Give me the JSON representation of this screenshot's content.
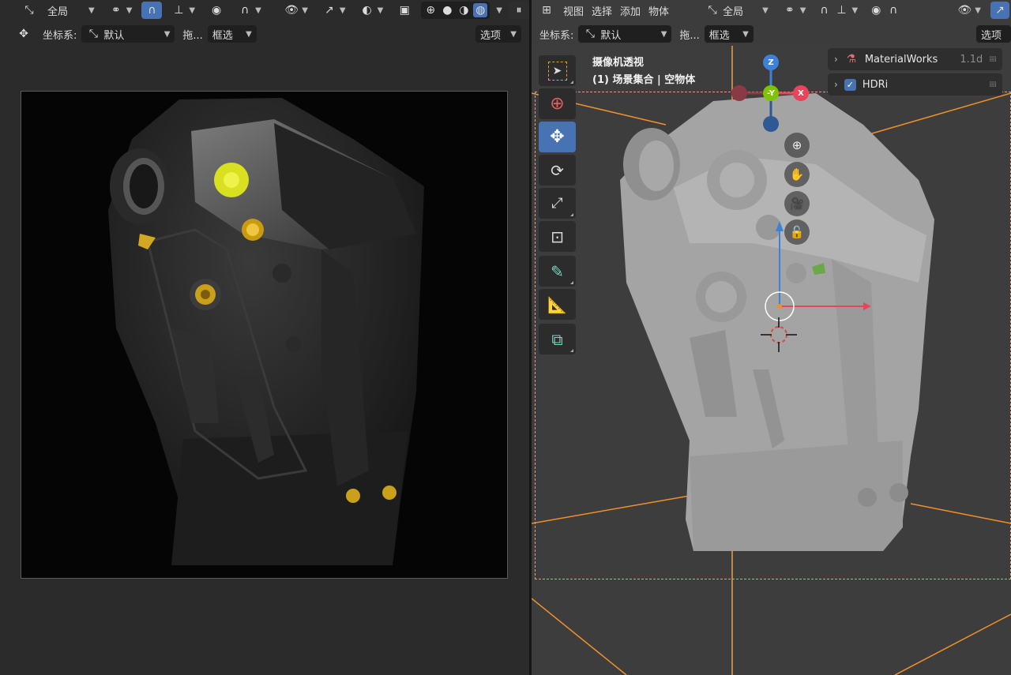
{
  "left_header": {
    "orientation_value": "全局",
    "coord_label": "坐标系:",
    "coord_value": "默认",
    "drag_label": "拖...",
    "select_mode": "框选",
    "options": "选项"
  },
  "right_header": {
    "menu": [
      "视图",
      "选择",
      "添加",
      "物体"
    ],
    "orientation_value": "全局",
    "coord_label": "坐标系:",
    "coord_value": "默认",
    "drag_label": "拖...",
    "select_mode": "框选",
    "options": "选项"
  },
  "viewport": {
    "title": "摄像机透视",
    "subtitle": "(1) 场景集合 | 空物体",
    "gizmo": {
      "z": "Z",
      "y": "-Y",
      "x": "X"
    }
  },
  "npanel": {
    "items": [
      {
        "label": "MaterialWorks",
        "version": "1.1d"
      },
      {
        "label": "HDRi",
        "checked": true
      }
    ]
  },
  "colors": {
    "accent": "#4772b3",
    "axis_x": "#e8445a",
    "axis_y": "#7fc400",
    "axis_z": "#3d82d6",
    "camera_lines": "#f0902a"
  }
}
